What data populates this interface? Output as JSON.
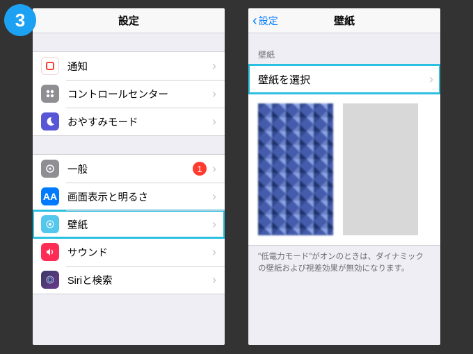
{
  "step_number": "3",
  "left": {
    "title": "設定",
    "group1": [
      {
        "label": "通知",
        "icon": "notifications-icon"
      },
      {
        "label": "コントロールセンター",
        "icon": "control-center-icon"
      },
      {
        "label": "おやすみモード",
        "icon": "dnd-icon"
      }
    ],
    "group2": [
      {
        "label": "一般",
        "icon": "general-icon",
        "badge": "1"
      },
      {
        "label": "画面表示と明るさ",
        "icon": "display-icon"
      },
      {
        "label": "壁紙",
        "icon": "wallpaper-icon",
        "highlighted": true
      },
      {
        "label": "サウンド",
        "icon": "sound-icon"
      },
      {
        "label": "Siriと検索",
        "icon": "siri-icon"
      }
    ],
    "display_glyph": "AA"
  },
  "right": {
    "back_label": "設定",
    "title": "壁紙",
    "section_header": "壁紙",
    "choose_label": "壁紙を選択",
    "footnote": "\"低電力モード\"がオンのときは、ダイナミックの壁紙および視差効果が無効になります。"
  }
}
